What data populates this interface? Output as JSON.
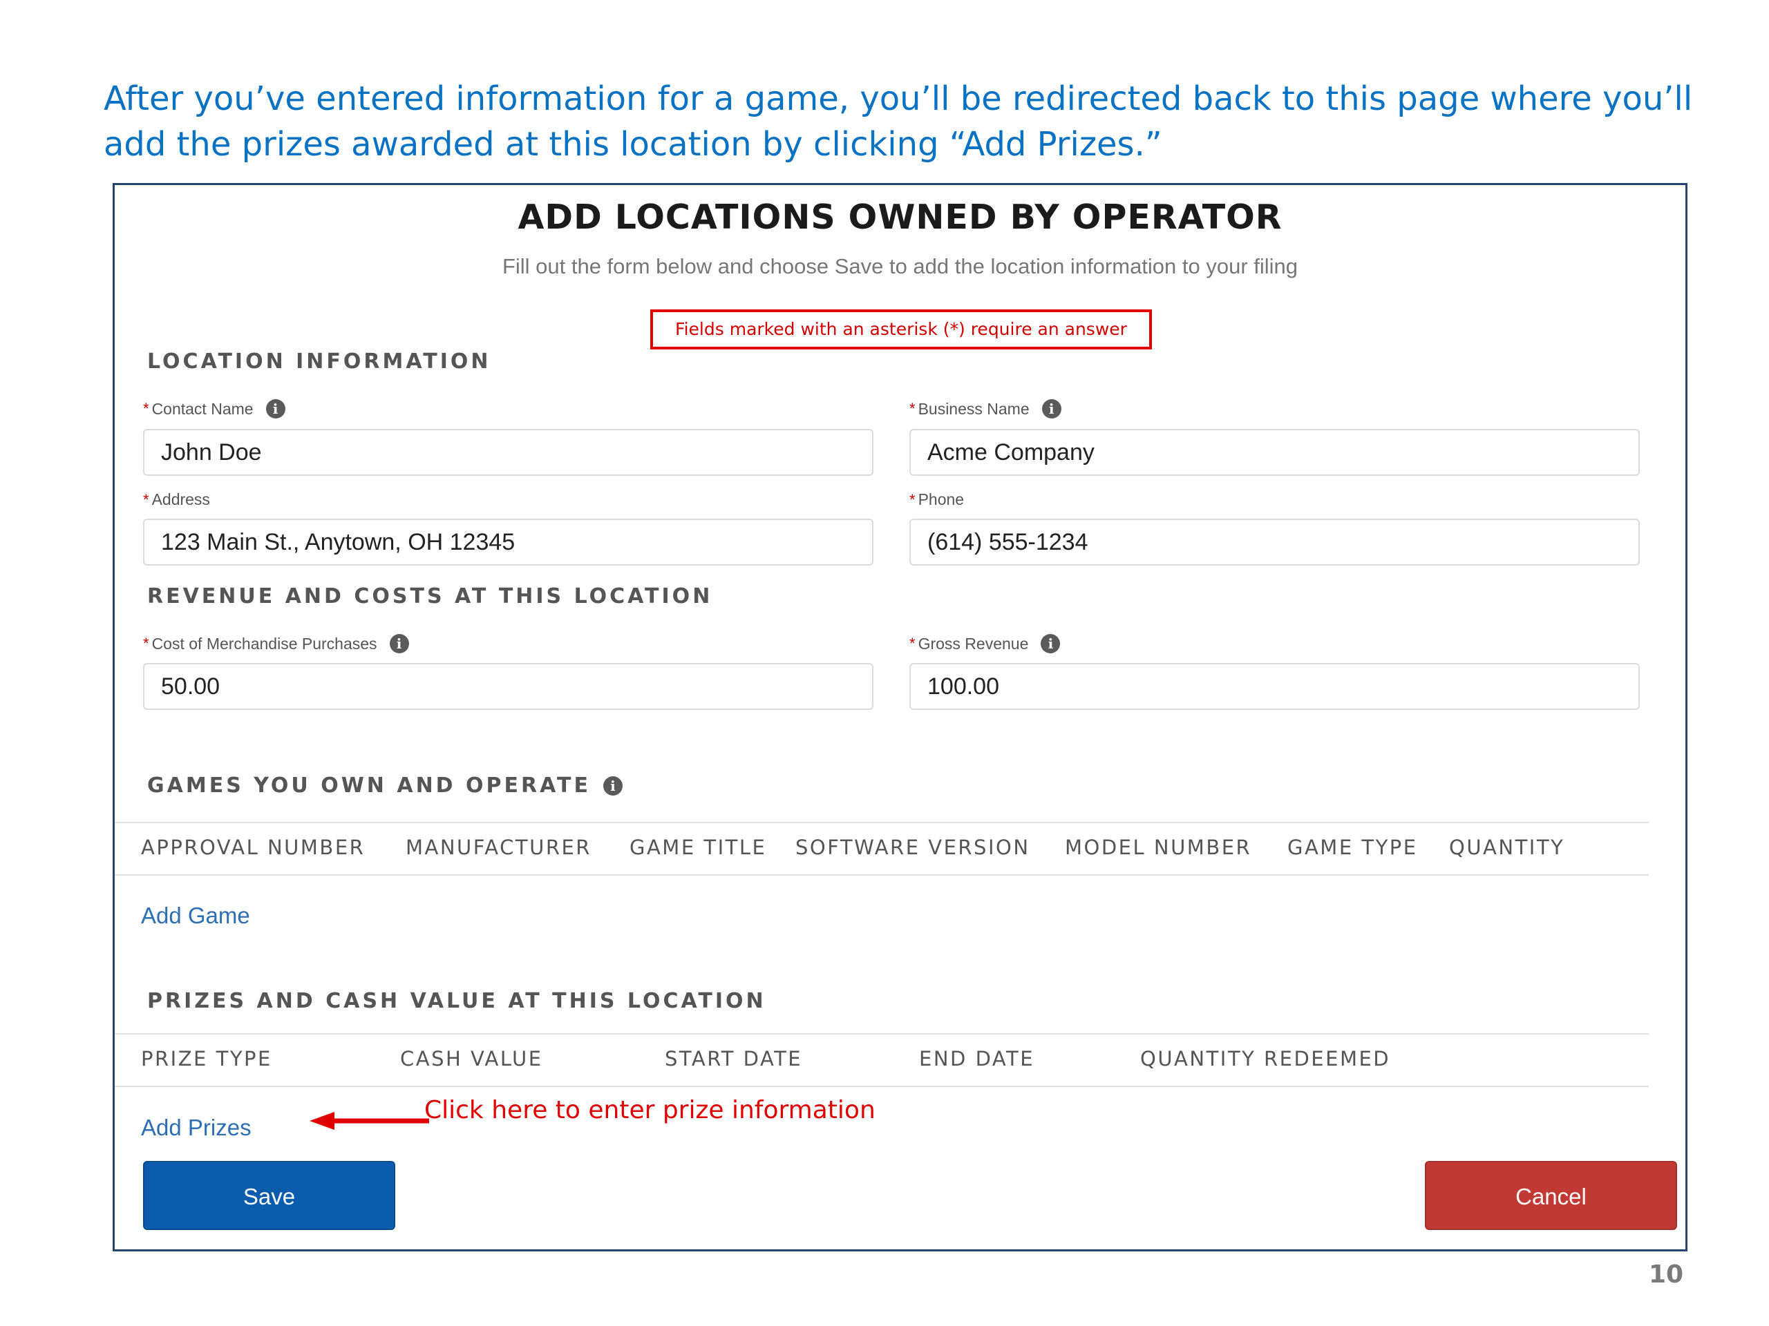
{
  "intro_text": "After you’ve entered information for a game, you’ll be redirected back to this page where you’ll add the prizes awarded at this location by clicking “Add Prizes.”",
  "form": {
    "title": "ADD LOCATIONS OWNED BY OPERATOR",
    "subtitle": "Fill out the form below and choose Save to add the location information to your filing",
    "notice": "Fields marked with an asterisk (*) require an answer"
  },
  "location": {
    "heading": "LOCATION INFORMATION",
    "contact_name_label": "Contact Name",
    "contact_name_value": "John Doe",
    "business_name_label": "Business Name",
    "business_name_value": "Acme Company",
    "address_label": "Address",
    "address_value": "123 Main St., Anytown, OH 12345",
    "phone_label": "Phone",
    "phone_value": "(614) 555-1234"
  },
  "revenue": {
    "heading": "REVENUE AND COSTS AT THIS LOCATION",
    "cost_label": "Cost of Merchandise Purchases",
    "cost_value": "50.00",
    "gross_label": "Gross Revenue",
    "gross_value": "100.00"
  },
  "games": {
    "heading": "GAMES YOU OWN AND OPERATE",
    "columns": [
      "APPROVAL NUMBER",
      "MANUFACTURER",
      "GAME TITLE",
      "SOFTWARE VERSION",
      "MODEL NUMBER",
      "GAME TYPE",
      "QUANTITY"
    ],
    "add_link": "Add Game"
  },
  "prizes": {
    "heading": "PRIZES AND CASH VALUE AT THIS LOCATION",
    "columns": [
      "PRIZE TYPE",
      "CASH VALUE",
      "START DATE",
      "END DATE",
      "QUANTITY REDEEMED"
    ],
    "add_link": "Add Prizes",
    "hint": "Click here to enter prize information"
  },
  "buttons": {
    "save": "Save",
    "cancel": "Cancel"
  },
  "required_marker": "*",
  "info_glyph": "i",
  "page_number": "10",
  "colors": {
    "intro_blue": "#0a72c3",
    "link_blue": "#2d6fb2",
    "save_blue": "#0b5cad",
    "cancel_red": "#c23934",
    "notice_red": "#e00000"
  }
}
